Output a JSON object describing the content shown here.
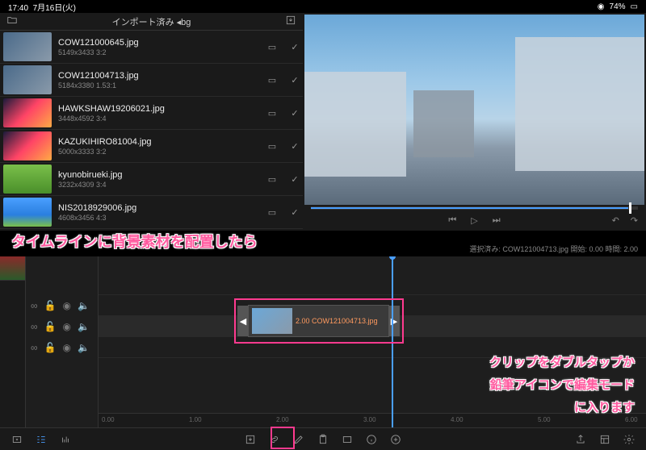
{
  "status": {
    "time": "17:40",
    "date": "7月16日(火)",
    "battery": "74%"
  },
  "lib": {
    "title": "インポート済み ◂bg",
    "items": [
      {
        "fn": "COW121000645.jpg",
        "meta": "5149x3433  3:2",
        "th": ""
      },
      {
        "fn": "COW121004713.jpg",
        "meta": "5184x3380  1.53:1",
        "th": ""
      },
      {
        "fn": "HAWKSHAW19206021.jpg",
        "meta": "3448x4592  3:4",
        "th": "n"
      },
      {
        "fn": "KAZUKIHIRO81004.jpg",
        "meta": "5000x3333  3:2",
        "th": "n"
      },
      {
        "fn": "kyunobirueki.jpg",
        "meta": "3232x4309  3:4",
        "th": "g"
      },
      {
        "fn": "NIS2018929006.jpg",
        "meta": "4608x3456  4:3",
        "th": "s"
      }
    ]
  },
  "sel": "選択済み: COW121004713.jpg  開始: 0.00  時間: 2.00",
  "clip": {
    "label": "2.00  COW121004713.jpg"
  },
  "ruler": [
    "0.00",
    "1.00",
    "2.00",
    "3.00",
    "4.00",
    "5.00",
    "6.00"
  ],
  "anno": {
    "a1": "タイムラインに背景素材を配置したら",
    "a2": "クリップをダブルタップか",
    "a3": "鉛筆アイコンで編集モード",
    "a4": "に入ります"
  }
}
